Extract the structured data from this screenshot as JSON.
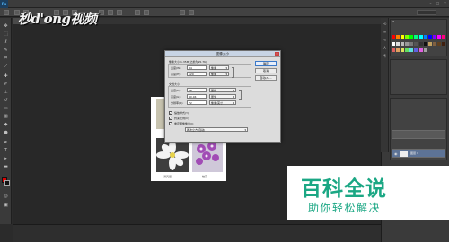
{
  "app": {
    "logo": "Ps",
    "menu": [
      "",
      "",
      "",
      "",
      "",
      "",
      "",
      "",
      "",
      "",
      ""
    ]
  },
  "watermark": {
    "text": "秒d'ong视频"
  },
  "dialog": {
    "title": "图像大小",
    "pixel_dimensions_label": "像素大小:1.35M(之前为95.7K)",
    "width_label": "宽度(W):",
    "width_value": "84",
    "width_unit": "像素",
    "height_label": "高度(H):",
    "height_value": "120",
    "height_unit": "像素",
    "document_size_label": "文档大小:",
    "doc_width_label": "宽度(D):",
    "doc_width_value": "28",
    "doc_width_unit": "厘米",
    "doc_height_label": "高度(G):",
    "doc_height_value": "40.94",
    "doc_height_unit": "厘米",
    "resolution_label": "分辨率(R):",
    "resolution_value": "72",
    "resolution_unit": "像素/英寸",
    "scale_styles_label": "缩放样式(Y)",
    "constrain_label": "约束比例(C)",
    "resample_label": "重定图像像素(I):",
    "resample_method": "两次立方(自动)",
    "ok_label": "确定",
    "cancel_label": "取消",
    "auto_label": "自动(A)..."
  },
  "document": {
    "label_left": "满天星",
    "label_right": "桔花"
  },
  "layers": {
    "layer_name": "图层 1"
  },
  "status": {
    "zoom": ""
  },
  "baike_logo": {
    "title": "百科全说",
    "subtitle": "助你轻松解决"
  },
  "colors": {
    "foreground": "#e00000",
    "background": "#111111",
    "baike_green": "#1ba784"
  }
}
